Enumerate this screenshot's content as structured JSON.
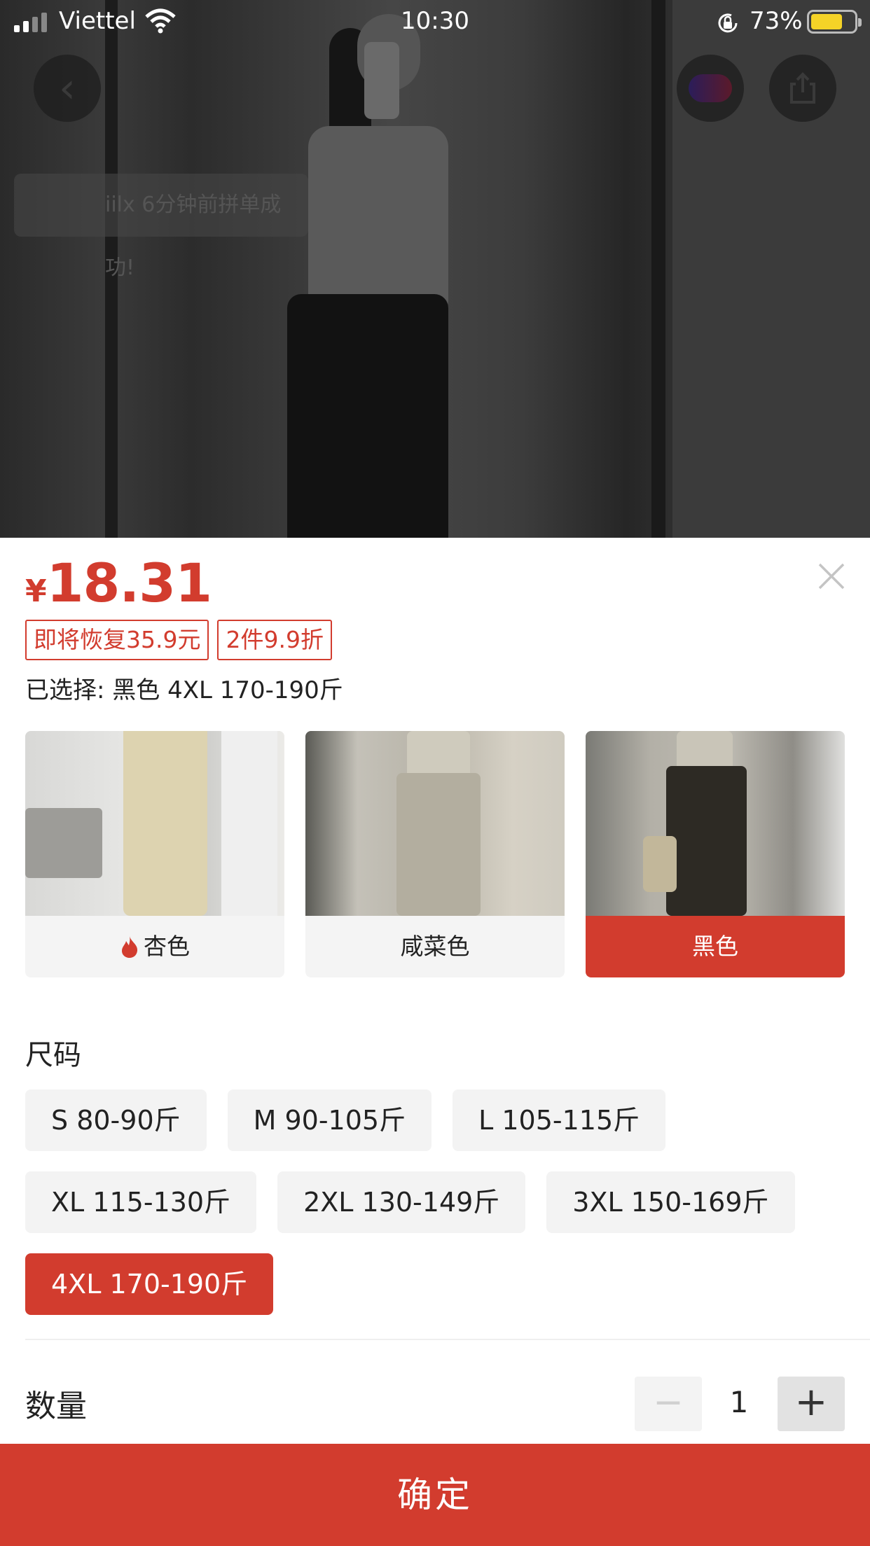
{
  "status_bar": {
    "carrier": "Viettel",
    "time": "10:30",
    "battery_percent": "73%",
    "battery_level": 0.73
  },
  "background": {
    "toast": "iilx 6分钟前拼单成功!"
  },
  "product": {
    "currency": "¥",
    "price": "18.31",
    "badges": [
      "即将恢复35.9元",
      "2件9.9折"
    ],
    "selected_text": "已选择: 黑色 4XL 170-190斤"
  },
  "colors": [
    {
      "label": "杏色",
      "hot": true,
      "selected": false
    },
    {
      "label": "咸菜色",
      "hot": false,
      "selected": false
    },
    {
      "label": "黑色",
      "hot": false,
      "selected": true
    }
  ],
  "size": {
    "title": "尺码",
    "options": [
      "S 80-90斤",
      "M 90-105斤",
      "L 105-115斤",
      "XL 115-130斤",
      "2XL 130-149斤",
      "3XL 150-169斤",
      "4XL 170-190斤"
    ],
    "selected": "4XL 170-190斤"
  },
  "quantity": {
    "label": "数量",
    "value": "1",
    "minus": "−",
    "plus": "+"
  },
  "confirm_label": "确定",
  "accent_color": "#d23c2e"
}
